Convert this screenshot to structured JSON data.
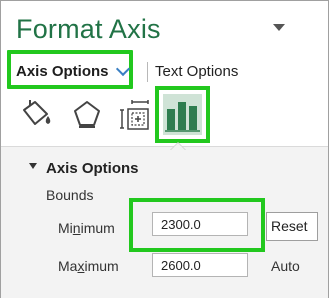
{
  "pane": {
    "title": "Format Axis",
    "tabs": [
      {
        "label": "Axis Options",
        "selected": true
      },
      {
        "label": "Text Options",
        "selected": false
      }
    ],
    "icon_tabs": [
      "fill-line-icon",
      "effects-icon",
      "size-properties-icon",
      "axis-options-icon"
    ],
    "accent_color": "#217346",
    "highlight_color": "#22c81e"
  },
  "axis_options": {
    "section_title": "Axis Options",
    "bounds_label": "Bounds",
    "minimum": {
      "label_pre": "Mi",
      "label_key": "n",
      "label_post": "imum",
      "value": "2300.0",
      "action": "Reset"
    },
    "maximum": {
      "label_pre": "Ma",
      "label_key": "x",
      "label_post": "imum",
      "value": "2600.0",
      "action": "Auto"
    }
  }
}
